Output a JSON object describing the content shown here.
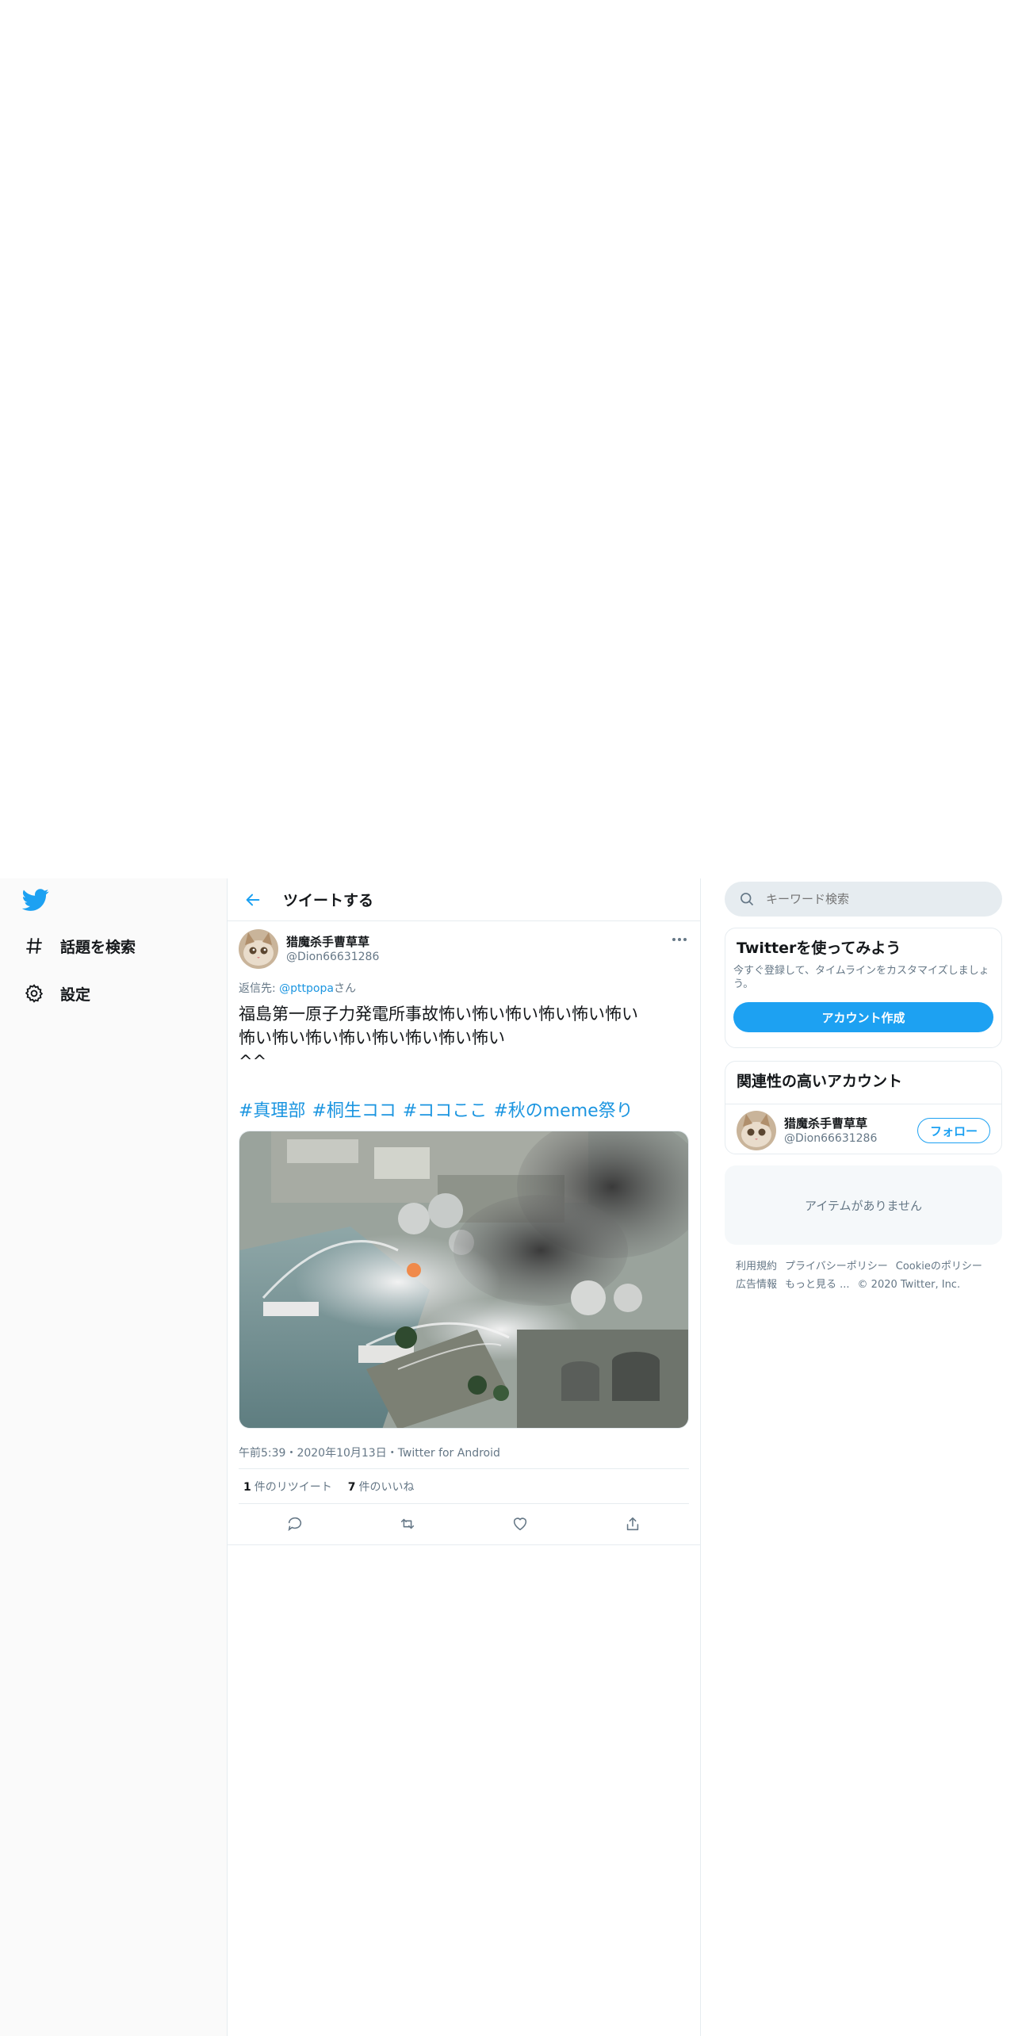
{
  "nav": {
    "items": [
      {
        "label": "話題を検索",
        "icon": "hashtag-icon"
      },
      {
        "label": "設定",
        "icon": "gear-icon"
      }
    ]
  },
  "header": {
    "title": "ツイートする"
  },
  "tweet": {
    "author_name": "猎魔杀手曹草草",
    "author_handle": "@Dion66631286",
    "reply_prefix": "返信先: ",
    "reply_handle": "@pttpopa",
    "reply_suffix": "さん",
    "body": "福島第一原子力発電所事故怖い怖い怖い怖い怖い怖い\n怖い怖い怖い怖い怖い怖い怖い怖い\n^^",
    "hashtags": [
      "#真理部",
      "#桐生ココ",
      "#ココここ",
      "#秋のmeme祭り"
    ],
    "meta": "午前5:39・2020年10月13日・Twitter for Android",
    "retweets_count": "1",
    "retweets_label": "件のリツイート",
    "likes_count": "7",
    "likes_label": "件のいいね"
  },
  "search": {
    "placeholder": "キーワード検索"
  },
  "signup_card": {
    "title": "Twitterを使ってみよう",
    "subtitle": "今すぐ登録して、タイムラインをカスタマイズしましょう。",
    "button": "アカウント作成"
  },
  "related_card": {
    "title": "関連性の高いアカウント",
    "name": "猎魔杀手曹草草",
    "handle": "@Dion66631286",
    "follow": "フォロー"
  },
  "trends": {
    "empty": "アイテムがありません"
  },
  "footer": {
    "links": [
      "利用規約",
      "プライバシーポリシー",
      "Cookieのポリシー",
      "広告情報",
      "もっと見る ..."
    ],
    "copyright": "© 2020 Twitter, Inc."
  },
  "colors": {
    "accent": "#1da1f2",
    "link": "#1b95e0",
    "muted": "#657786"
  }
}
